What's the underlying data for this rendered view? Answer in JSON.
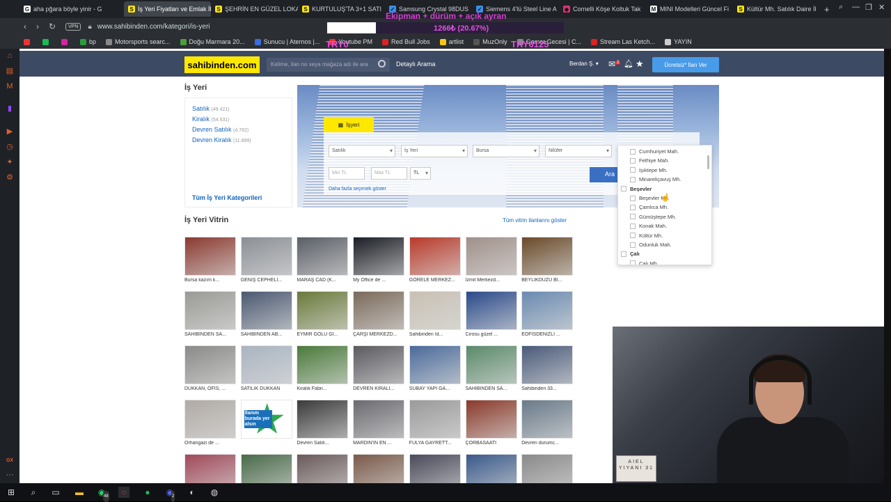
{
  "browser": {
    "tabs": [
      {
        "label": "aha pğara böyle yinir - G",
        "color": "#ffffff",
        "glyph": "G"
      },
      {
        "label": "İş Yeri Fiyatları ve Emlak İl",
        "color": "#ffe800",
        "glyph": "S",
        "active": true
      },
      {
        "label": "ŞEHRİN EN GÜZEL LOKA",
        "color": "#ffe800",
        "glyph": "S"
      },
      {
        "label": "KURTULUŞ'TA 3+1 SATI",
        "color": "#ffe800",
        "glyph": "S"
      },
      {
        "label": "Samsung Crystal 98DUS",
        "color": "#3a8ee6",
        "glyph": "✓"
      },
      {
        "label": "Siemens 4'lü Steel Line A",
        "color": "#3a8ee6",
        "glyph": "✓"
      },
      {
        "label": "Cornelli Köşe Koltuk Tak",
        "color": "#e0307a",
        "glyph": "◆"
      },
      {
        "label": "MINI Modelleri Güncel Fi",
        "color": "#ffffff",
        "glyph": "M"
      },
      {
        "label": "Kültür Mh. Satılık Daire İl",
        "color": "#ffe800",
        "glyph": "S"
      }
    ],
    "vpn_label": "VPN",
    "url": "www.sahibinden.com/kategori/is-yeri",
    "bookmarks": [
      {
        "label": "",
        "color": "#e33"
      },
      {
        "label": "",
        "color": "#1db954"
      },
      {
        "label": "",
        "color": "#d6249f"
      },
      {
        "label": "bp",
        "color": "#2a9d3a"
      },
      {
        "label": "Motorsports searc...",
        "color": "#888"
      },
      {
        "label": "Doğu Marmara 20...",
        "color": "#4c9e3c"
      },
      {
        "label": "Sunucu | Aternos |...",
        "color": "#3a6ee0"
      },
      {
        "label": "Youtube PM",
        "color": "#e33"
      },
      {
        "label": "Red Bull Jobs",
        "color": "#d22"
      },
      {
        "label": "artlist",
        "color": "#f5c518"
      },
      {
        "label": "MuzOnly",
        "color": "#555"
      },
      {
        "label": "Gamer Gecesi | C...",
        "color": "#888"
      },
      {
        "label": "Stream Las Ketch...",
        "color": "#d22"
      },
      {
        "label": "YAYIN",
        "color": "#ccc"
      }
    ]
  },
  "overlay": {
    "title": "Ekipman + dürüm + açık ayran",
    "progress_text": "1266₺ (20.67%)",
    "progress_fraction": 0.2067,
    "left_value": "TRY0",
    "right_value": "TRY6125"
  },
  "site": {
    "logo": "sahibinden.com",
    "search_placeholder": "Kelime, ilan no veya mağaza adı ile ara",
    "advanced_search": "Detaylı Arama",
    "user_name": "Berdan Ş.",
    "mail_badge": "2",
    "post_button": "Ücretsiz* İlan Ver"
  },
  "category": {
    "title": "İş Yeri",
    "links": [
      {
        "label": "Satılık",
        "count": "(49.421)"
      },
      {
        "label": "Kiralık",
        "count": "(54.531)"
      },
      {
        "label": "Devren Satılık",
        "count": "(4.782)"
      },
      {
        "label": "Devren Kiralık",
        "count": "(11.899)"
      }
    ],
    "all_link": "Tüm İş Yeri Kategorileri"
  },
  "search_panel": {
    "tab_label": "İşyeri",
    "selects": [
      "Satılık",
      "İş Yeri",
      "Bursa",
      "Nilüfer"
    ],
    "min_placeholder": "Min TL",
    "max_placeholder": "Max TL",
    "currency": "TL",
    "more_link": "Daha fazla seçenek göster",
    "search_button": "Ara"
  },
  "district_dropdown": {
    "rows": [
      {
        "label": "Cumhuriyet Mah.",
        "group": false
      },
      {
        "label": "Fethiye Mah.",
        "group": false
      },
      {
        "label": "Işıktepe Mh.",
        "group": false
      },
      {
        "label": "Minareliçavuş Mh.",
        "group": false
      },
      {
        "label": "Beşevler",
        "group": true
      },
      {
        "label": "Beşevler Mh.",
        "group": false
      },
      {
        "label": "Çamlıca Mh.",
        "group": false
      },
      {
        "label": "Gümüştepe Mh.",
        "group": false
      },
      {
        "label": "Konak Mah.",
        "group": false
      },
      {
        "label": "Kültür Mh.",
        "group": false
      },
      {
        "label": "Odunluk Mah.",
        "group": false
      },
      {
        "label": "Çalı",
        "group": true
      },
      {
        "label": "Çalı Mh.",
        "group": false
      }
    ]
  },
  "vitrin": {
    "title": "İş Yeri Vitrin",
    "all_link": "Tüm vitrin ilanlarını göster",
    "items": [
      {
        "caption": "Bursa kazım k...",
        "color": "#8a3a30"
      },
      {
        "caption": "GENİŞ CEPHELİ...",
        "color": "#8b8f95"
      },
      {
        "caption": "MARAŞ CAD (K...",
        "color": "#5a5e66"
      },
      {
        "caption": "My Office de ...",
        "color": "#1a1d24"
      },
      {
        "caption": "GÖRELE MERKEZ...",
        "color": "#b83a2a"
      },
      {
        "caption": "İzmit Merkezd...",
        "color": "#a0908a"
      },
      {
        "caption": "BEYLİKDÜZÜ Bİ...",
        "color": "#6a4a2a"
      },
      {
        "caption": "SAHİBİNDEN SA...",
        "color": "#9a9a96"
      },
      {
        "caption": "SAHİBİNDEN AB...",
        "color": "#4a5870"
      },
      {
        "caption": "EYMİR GÖLÜ Gİ...",
        "color": "#6a7a3a"
      },
      {
        "caption": "ÇARŞI MERKEZD...",
        "color": "#7a6a5a"
      },
      {
        "caption": "Sahibinden İd...",
        "color": "#c8c0b4"
      },
      {
        "caption": "Cirosu güzel ...",
        "color": "#2a4a8a"
      },
      {
        "caption": "EOFİSDENİZLİ ...",
        "color": "#6a8ab0"
      },
      {
        "caption": "DÜKKAN, OFİS, ...",
        "color": "#8a8a88"
      },
      {
        "caption": "SATILIK DÜKKAN",
        "color": "#aab4c0"
      },
      {
        "caption": "Kiralık Fabri...",
        "color": "#4a7a3a"
      },
      {
        "caption": "DEVREN KİRALI...",
        "color": "#5a5a60"
      },
      {
        "caption": "SUBAY YAPI GA...",
        "color": "#4a6a9a"
      },
      {
        "caption": "SAHİBİNDEN SA...",
        "color": "#5a8a6a"
      },
      {
        "caption": "Sahibinden 33...",
        "color": "#4a5a7a"
      },
      {
        "caption": "Orhangazi de ...",
        "color": "#b0aaa4"
      },
      {
        "caption": "",
        "color": "#2a6ab0"
      },
      {
        "caption": "Devren Satılı...",
        "color": "#3a3a3a"
      },
      {
        "caption": "MARDİN'İN EN ...",
        "color": "#6a6a70"
      },
      {
        "caption": "FULYA GAYRETT...",
        "color": "#9a9a9a"
      },
      {
        "caption": "ÇORBASAATİ",
        "color": "#8a3a2a"
      },
      {
        "caption": "Devren durumc...",
        "color": "#6a7a8a"
      },
      {
        "caption": "",
        "color": "#a04a5a"
      },
      {
        "caption": "",
        "color": "#4a6a4a"
      },
      {
        "caption": "",
        "color": "#6a5a5a"
      },
      {
        "caption": "",
        "color": "#7a5a4a"
      },
      {
        "caption": "",
        "color": "#4a4a5a"
      },
      {
        "caption": "",
        "color": "#3a5a8a"
      },
      {
        "caption": "",
        "color": "#8a8a8a"
      }
    ],
    "badge_text": "İlanım burada yer alsın"
  },
  "webcam": {
    "sign_text": "AIEL YIYANI 31"
  },
  "taskbar": {
    "whatsapp_badge": "48",
    "discord_badge": "2"
  }
}
